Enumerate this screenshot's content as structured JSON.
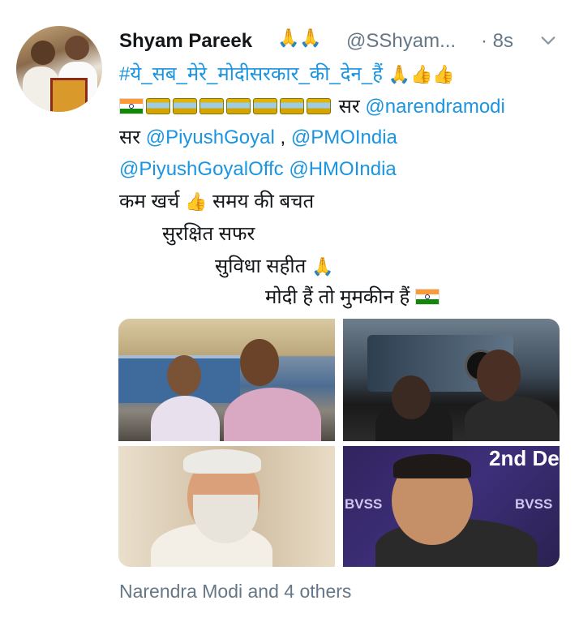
{
  "tweet": {
    "author_name": "Shyam Pareek",
    "author_emoji": "🙏🙏",
    "handle": "@SShyam...",
    "separator": "·",
    "time": "8s",
    "lines": {
      "hashtag": "#ये_सब_मेरे_मोदीसरकार_की_देन_हैं",
      "hashtag_emoji": "🙏👍👍",
      "sar1": "सर",
      "mention1": "@narendramodi",
      "sar2": "सर",
      "mention2": "@PiyushGoyal",
      "comma": " , ",
      "mention3": "@PMOIndia",
      "mention4": "@PiyushGoyalOffc",
      "mention5": "@HMOIndia",
      "line5a": "कम खर्च",
      "thumbs": "👍",
      "line5b": "समय की बचत",
      "line6": "सुरक्षित सफर",
      "line7": "सुविधा सहीत",
      "pray": "🙏",
      "line8": "मोदी हैं तो मुमकीन हैं"
    },
    "photos": [
      {
        "name": "selfie-platform-photo"
      },
      {
        "name": "selfie-night-locomotive-photo"
      },
      {
        "name": "narendra-modi-photo"
      },
      {
        "name": "piyush-goyal-photo",
        "sign_text_1": "2nd De",
        "sign_text_2": "BVSS",
        "sign_text_3": "BVSS"
      }
    ],
    "tagged": "Narendra Modi and 4 others"
  },
  "colors": {
    "link": "#1b95e0",
    "muted": "#657786",
    "text": "#14171a"
  },
  "icons": [
    "chevron-down-icon",
    "india-flag-icon",
    "train-icon"
  ]
}
